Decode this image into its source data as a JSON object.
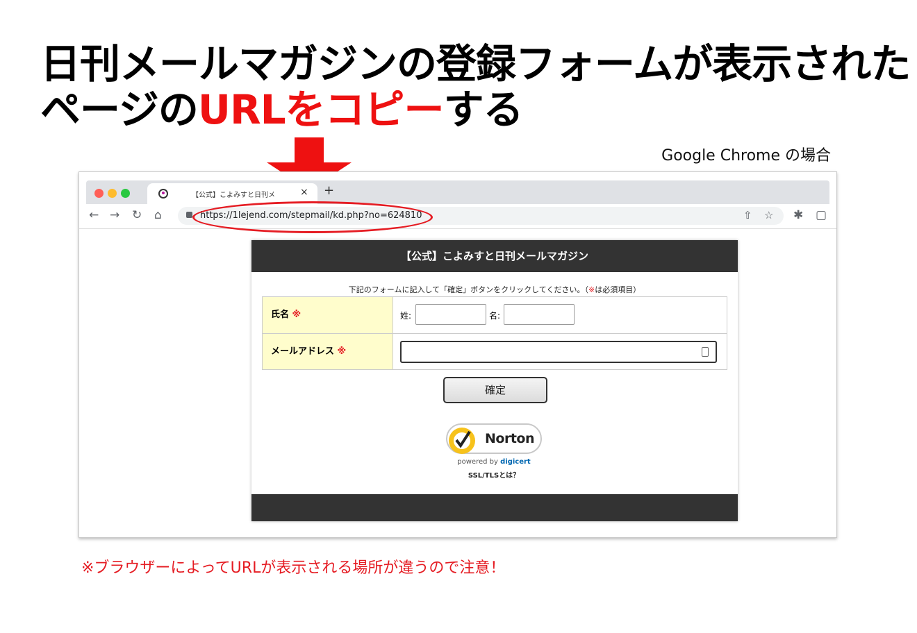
{
  "headline": {
    "line1": "日刊メールマガジンの登録フォームが表示された",
    "line2_prefix": "ページの",
    "line2_highlight": "URLをコピー",
    "line2_suffix": "する"
  },
  "browser_caption": "Google Chrome の場合",
  "browser": {
    "tab": {
      "title": "【公式】こよみすと日刊メ",
      "close_icon": "×",
      "newtab_icon": "+"
    },
    "toolbar": {
      "back_icon": "←",
      "forward_icon": "→",
      "reload_icon": "↻",
      "home_icon": "⌂",
      "url": "https://1lejend.com/stepmail/kd.php?no=624810",
      "share_icon": "⇧",
      "bookmark_icon": "☆",
      "extensions_icon": "✱",
      "sidepanel_icon": "▢"
    }
  },
  "site": {
    "header": "【公式】こよみすと日刊メールマガジン",
    "instruction_prefix": "下記のフォームに記入して「確定」ボタンをクリックしてください。（",
    "instruction_mark": "※",
    "instruction_suffix": "は必須項目）",
    "form": {
      "name_label": "氏名",
      "required_mark": "※",
      "last_name_label": "姓:",
      "first_name_label": "名:",
      "last_name_value": "",
      "first_name_value": "",
      "email_label": "メールアドレス",
      "email_value": ""
    },
    "confirm_button": "確定",
    "norton": {
      "brand": "Norton",
      "powered_by": "powered by",
      "digicert": "digicert",
      "ssl_link": "SSL/TLSとは？"
    }
  },
  "note": "※ブラウザーによってURLが表示される場所が違うので注意！",
  "colors": {
    "accent_red": "#ee1111",
    "header_dark": "#333333",
    "label_bg": "#fffdcc"
  }
}
